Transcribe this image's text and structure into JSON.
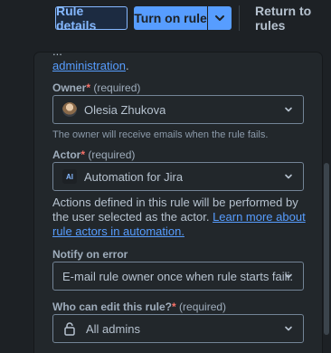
{
  "toolbar": {
    "details_label": "Rule details",
    "turn_on_label": "Turn on rule",
    "return_label": "Return to rules"
  },
  "intro": {
    "partial_text": "...",
    "line2_link": "administration",
    "line2_suffix": "."
  },
  "owner": {
    "label": "Owner",
    "star": "*",
    "required_text": "(required)",
    "value": "Olesia Zhukova",
    "helper": "The owner will receive emails when the rule fails."
  },
  "actor": {
    "label": "Actor",
    "star": "*",
    "required_text": "(required)",
    "icon_text": "AI",
    "value": "Automation for Jira",
    "desc_text": "Actions defined in this rule will be performed by the user selected as the actor.",
    "desc_link": "Learn more about rule actors in automation."
  },
  "notify": {
    "label": "Notify on error",
    "value": "E-mail rule owner once when rule starts faili..."
  },
  "edit": {
    "label": "Who can edit this rule?",
    "star": "*",
    "required_text": "(required)",
    "value": "All admins"
  },
  "icons": {
    "caret": "chevron-down-icon",
    "lock": "lock-icon",
    "avatar": "user-avatar",
    "app": "automation-app-icon"
  }
}
